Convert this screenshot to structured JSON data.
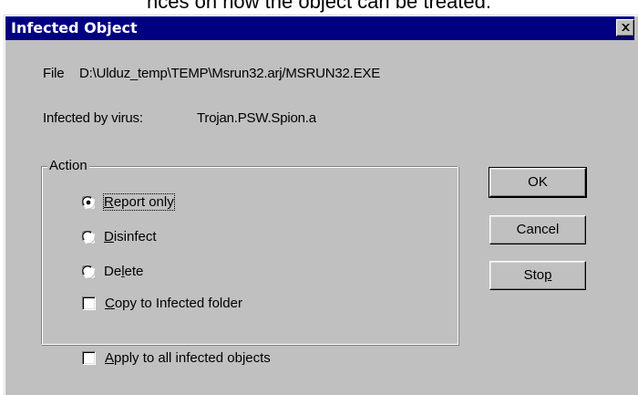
{
  "top_caption": "nces on how the object can be treated.",
  "dialog": {
    "title": "Infected Object",
    "file_label": "File",
    "file_path": "D:\\Ulduz_temp\\TEMP\\Msrun32.arj/MSRUN32.EXE",
    "virus_label": "Infected by virus:",
    "virus_name": "Trojan.PSW.Spion.a"
  },
  "action_group": {
    "legend": "Action",
    "options": [
      {
        "pre": "",
        "key": "R",
        "post": "eport only",
        "selected": true
      },
      {
        "pre": "",
        "key": "D",
        "post": "isinfect",
        "selected": false
      },
      {
        "pre": "De",
        "key": "l",
        "post": "ete",
        "selected": false
      }
    ],
    "copy_checkbox": {
      "pre": "",
      "key": "C",
      "post": "opy to Infected folder",
      "checked": false
    }
  },
  "apply_all": {
    "pre": "",
    "key": "A",
    "post": "pply to all infected objects",
    "checked": false
  },
  "buttons": {
    "ok": "OK",
    "cancel": "Cancel",
    "stop_pre": "Sto",
    "stop_key": "p",
    "stop_post": ""
  }
}
